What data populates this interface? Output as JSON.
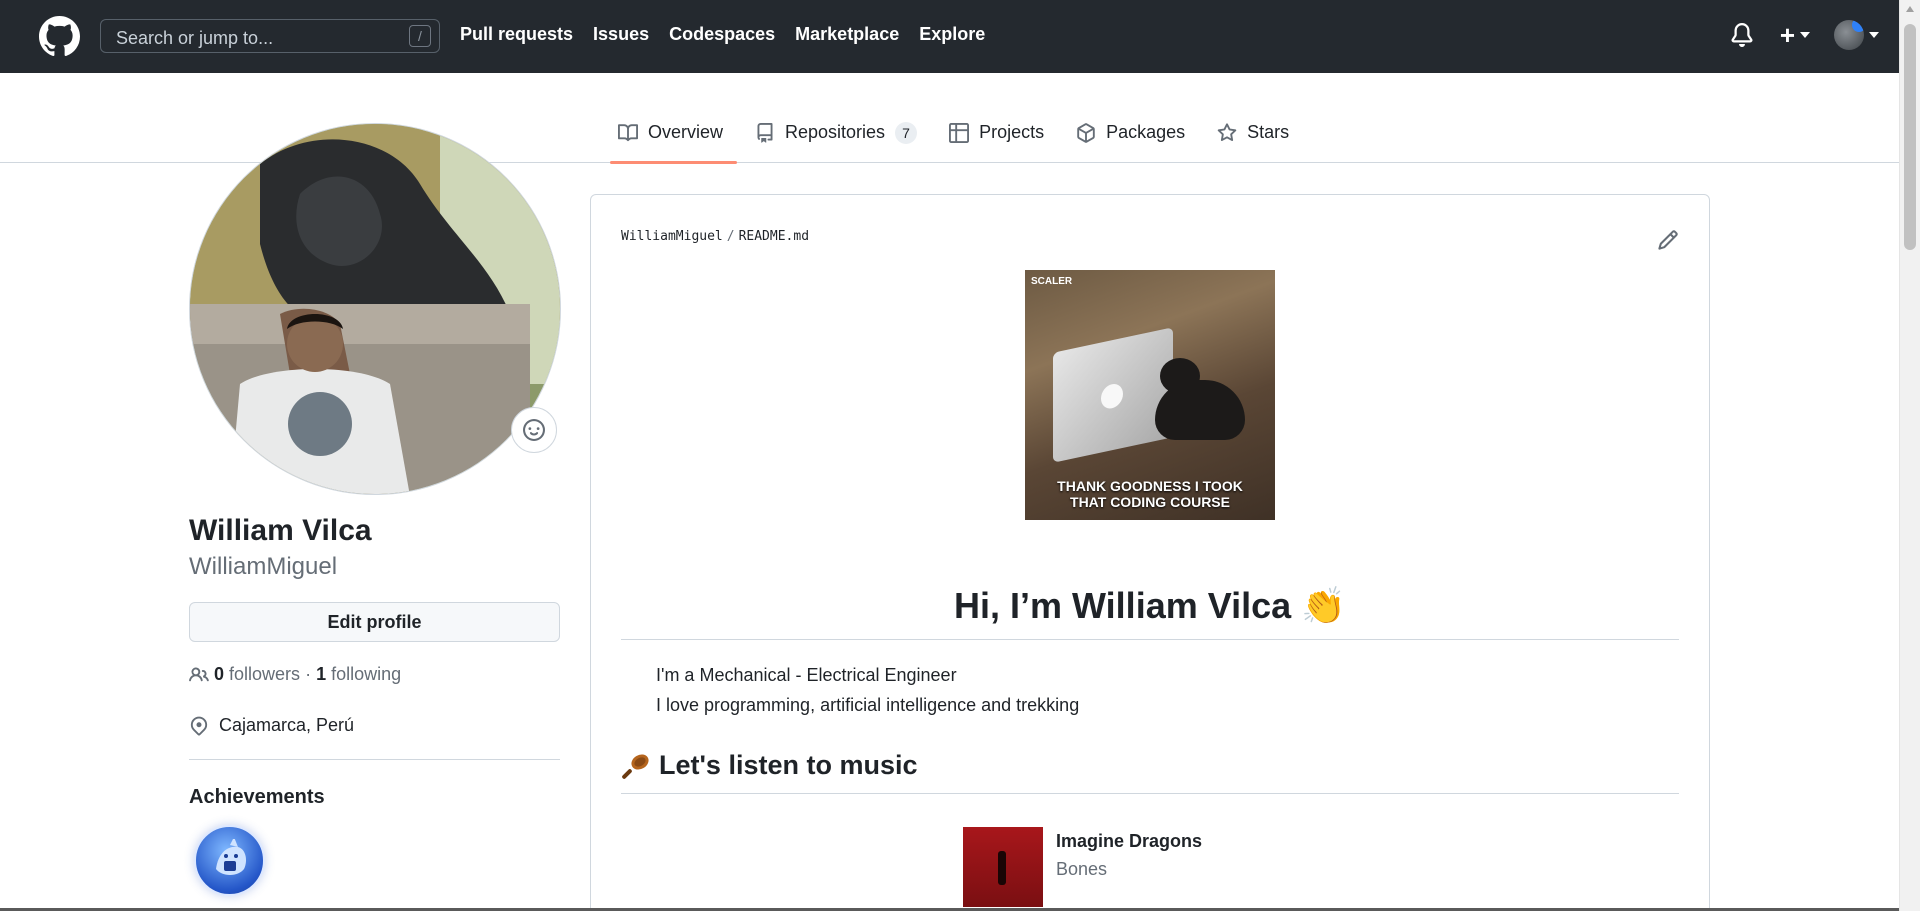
{
  "header": {
    "search_placeholder": "Search or jump to...",
    "search_shortcut": "/",
    "nav": [
      "Pull requests",
      "Issues",
      "Codespaces",
      "Marketplace",
      "Explore"
    ],
    "icons": [
      "github-logo-icon",
      "bell-icon",
      "plus-icon",
      "avatar"
    ]
  },
  "tabs": [
    {
      "label": "Overview",
      "icon": "book-icon",
      "active": true
    },
    {
      "label": "Repositories",
      "icon": "repo-icon",
      "count": "7"
    },
    {
      "label": "Projects",
      "icon": "table-icon"
    },
    {
      "label": "Packages",
      "icon": "package-icon"
    },
    {
      "label": "Stars",
      "icon": "star-icon"
    }
  ],
  "profile": {
    "full_name": "William Vilca",
    "login": "WilliamMiguel",
    "edit_profile": "Edit profile",
    "followers_count": "0",
    "followers_label": "followers",
    "separator": "·",
    "following_count": "1",
    "following_label": "following",
    "location": "Cajamarca, Perú",
    "achievements_title": "Achievements"
  },
  "readme": {
    "owner": "WilliamMiguel",
    "path_sep": "/",
    "file": "README.md",
    "gif_brand": "SCALER",
    "gif_caption_1": "THANK GOODNESS I TOOK",
    "gif_caption_2": "THAT CODING COURSE",
    "heading": "Hi, I’m William Vilca",
    "heading_emoji": "👏",
    "bio_line_1": "I'm a Mechanical - Electrical Engineer",
    "bio_line_2": "I love programming, artificial intelligence and trekking",
    "music_heading": "Let's listen to music",
    "artist": "Imagine Dragons",
    "song": "Bones"
  },
  "colors": {
    "header_bg": "#24292f",
    "active_tab_underline": "#fd8c73",
    "border": "#d0d7de",
    "muted_text": "#656d76"
  }
}
